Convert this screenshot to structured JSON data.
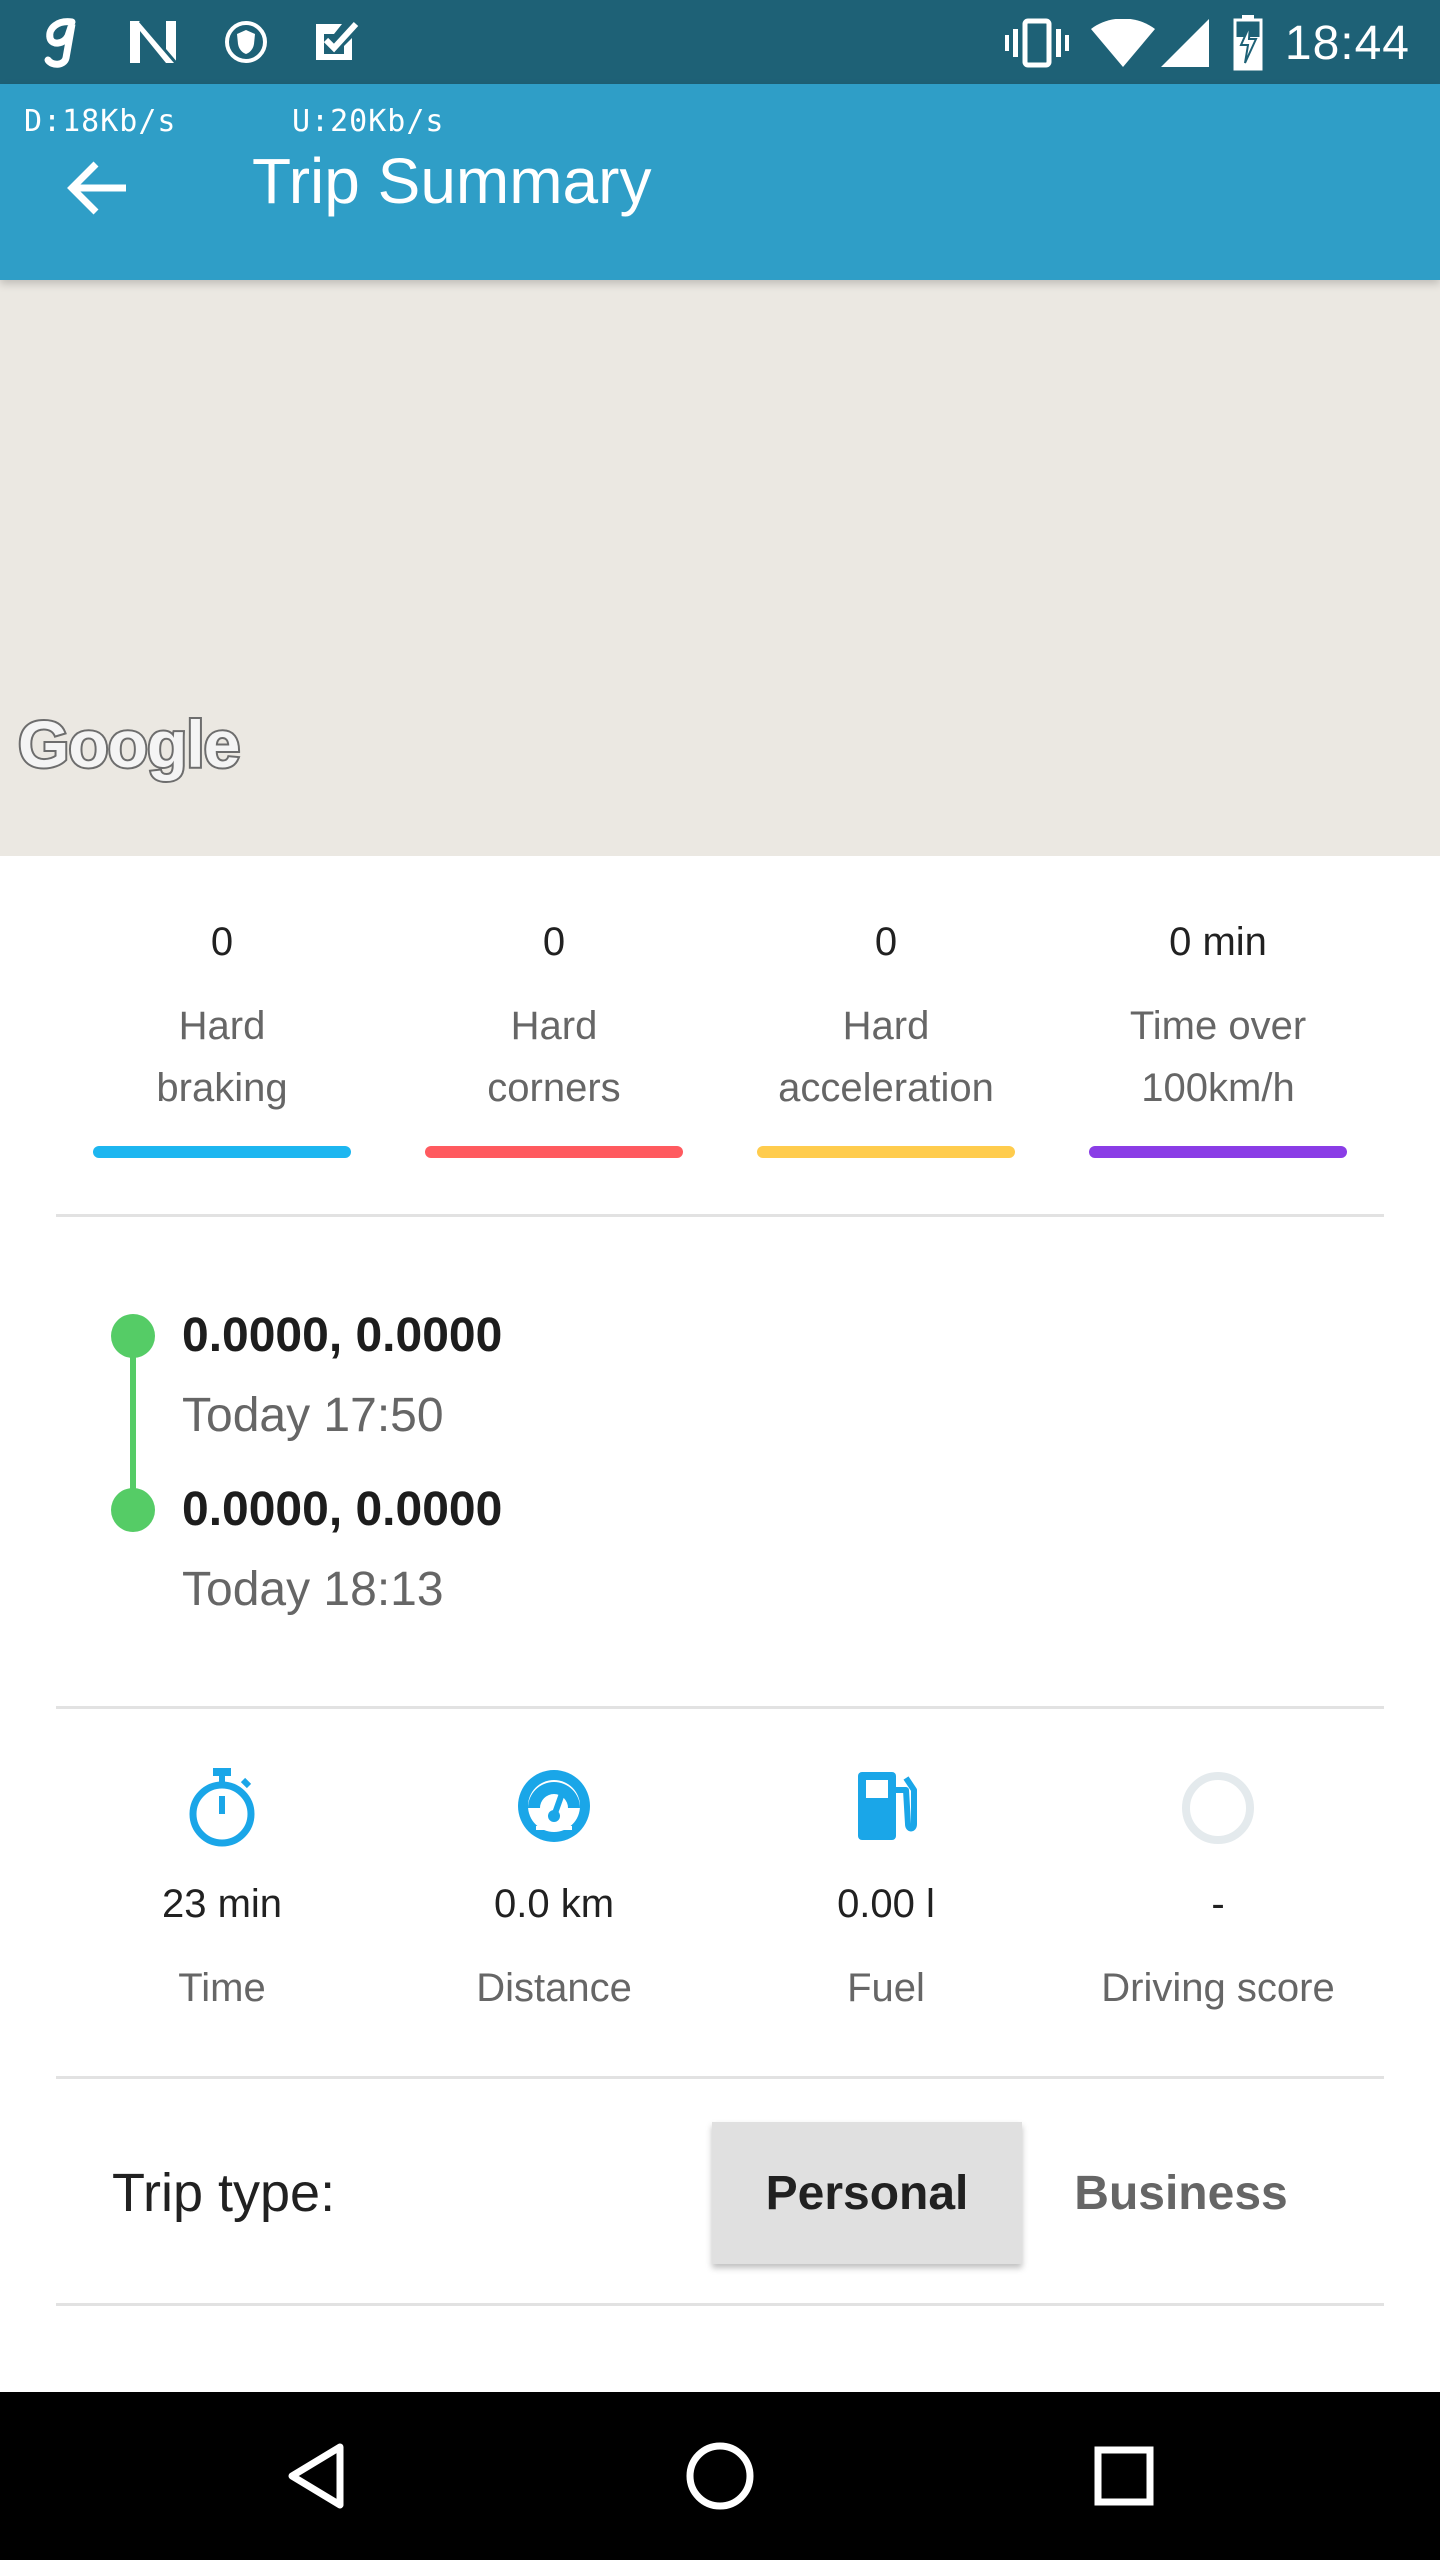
{
  "status_bar": {
    "time": "18:44",
    "left_icons": [
      "g-notification-icon",
      "n-notification-icon",
      "vpn-shield-icon",
      "task-check-icon"
    ],
    "right_icons": [
      "vibrate-icon",
      "wifi-icon",
      "cell-signal-icon",
      "battery-icon"
    ]
  },
  "app_bar": {
    "download_speed": "D:18Kb/s",
    "upload_speed": "U:20Kb/s",
    "title": "Trip Summary",
    "back_icon": "arrow-back-icon",
    "color": "#2f9ec7"
  },
  "map": {
    "attribution": "Google",
    "background": "#ebe8e2"
  },
  "events": [
    {
      "count": "0",
      "label_line1": "Hard",
      "label_line2": "braking",
      "color": "#1db6f0"
    },
    {
      "count": "0",
      "label_line1": "Hard",
      "label_line2": "corners",
      "color": "#ff5a5f"
    },
    {
      "count": "0",
      "label_line1": "Hard",
      "label_line2": "acceleration",
      "color": "#ffcc4d"
    },
    {
      "count": "0 min",
      "label_line1": "Time over",
      "label_line2": "100km/h",
      "color": "#8a3de6"
    }
  ],
  "route": {
    "start": {
      "coords": "0.0000, 0.0000",
      "time": "Today 17:50"
    },
    "end": {
      "coords": "0.0000, 0.0000",
      "time": "Today 18:13"
    },
    "color": "#55cc66"
  },
  "metrics": [
    {
      "icon": "stopwatch-icon",
      "value": "23 min",
      "label": "Time"
    },
    {
      "icon": "speedometer-icon",
      "value": "0.0 km",
      "label": "Distance"
    },
    {
      "icon": "fuel-pump-icon",
      "value": "0.00 l",
      "label": "Fuel"
    },
    {
      "icon": "score-ring-icon",
      "value": "-",
      "label": "Driving score"
    }
  ],
  "trip_type": {
    "label": "Trip type:",
    "options": [
      "Personal",
      "Business"
    ],
    "selected": "Personal"
  },
  "nav_bar": {
    "buttons": [
      "back-triangle-icon",
      "home-circle-icon",
      "recents-square-icon"
    ]
  }
}
